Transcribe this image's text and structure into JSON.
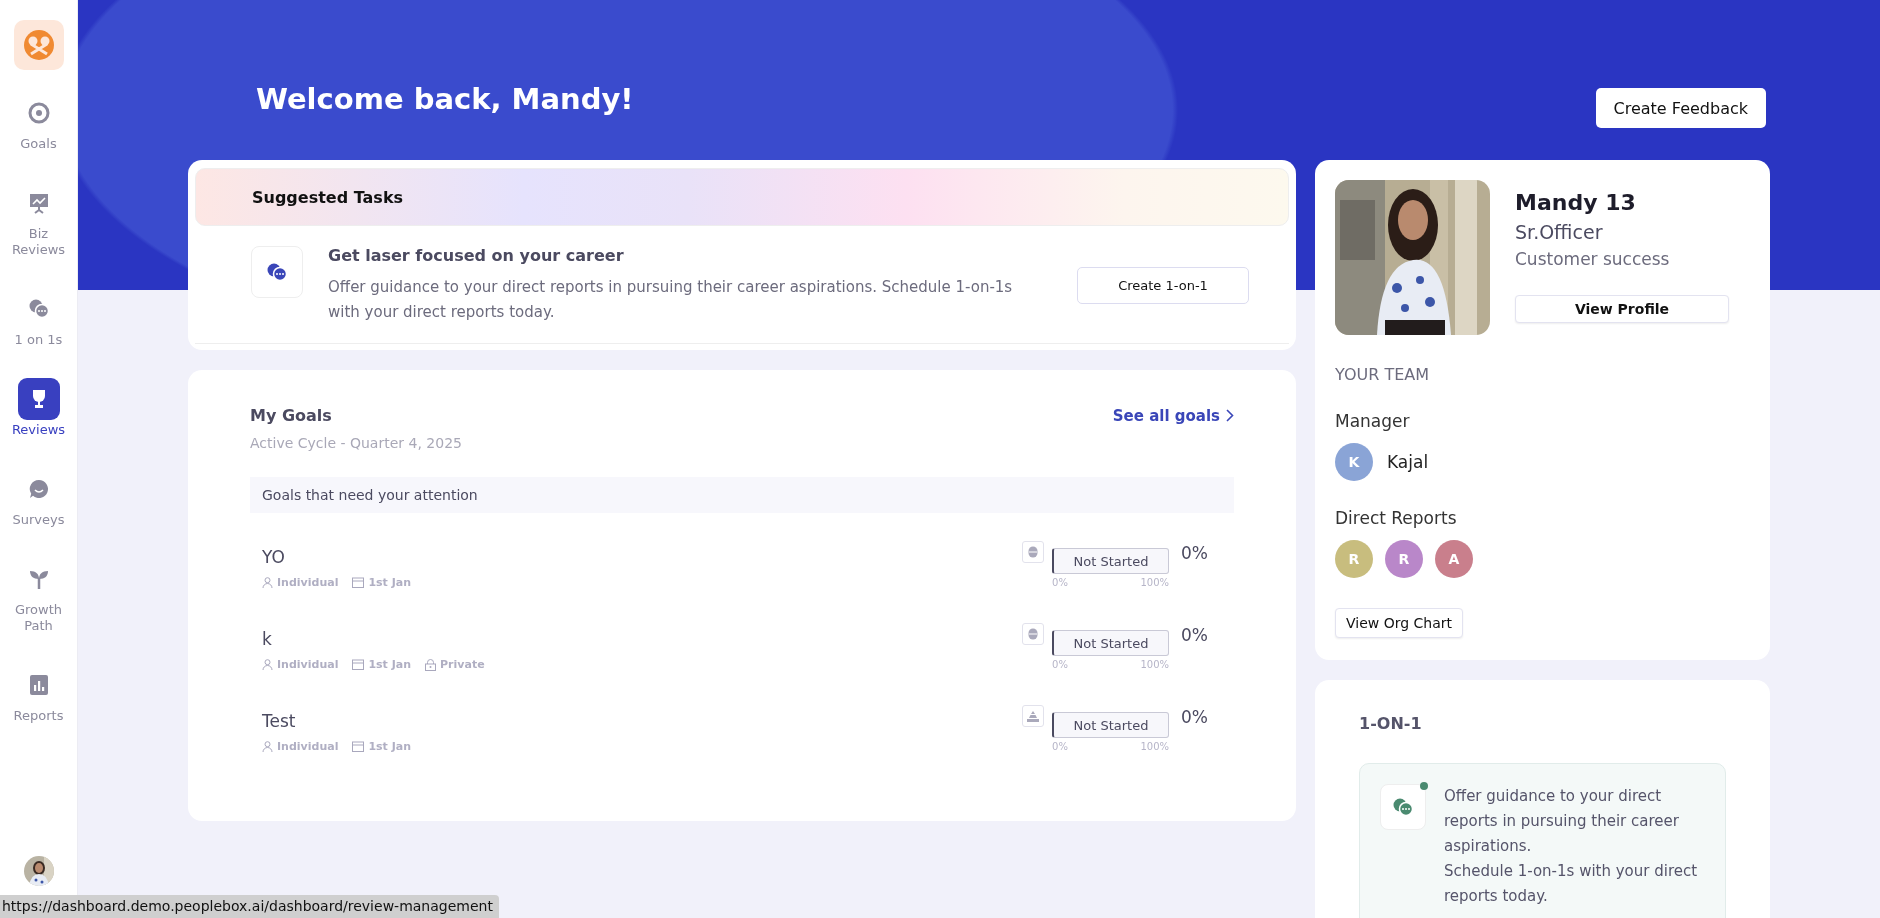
{
  "sidebar": {
    "items": [
      {
        "label": "Goals",
        "kind": "target",
        "selected": false
      },
      {
        "label": "Biz Reviews",
        "kind": "presentation",
        "selected": false
      },
      {
        "label": "1 on 1s",
        "kind": "chat",
        "selected": false
      },
      {
        "label": "Reviews",
        "kind": "trophy",
        "selected": true
      },
      {
        "label": "Surveys",
        "kind": "bubble",
        "selected": false
      },
      {
        "label": "Growth Path",
        "kind": "sprout",
        "selected": false
      },
      {
        "label": "Reports",
        "kind": "chart",
        "selected": false
      }
    ]
  },
  "header": {
    "title": "Welcome back, Mandy!",
    "button": "Create Feedback"
  },
  "suggested_tasks": {
    "title": "Suggested Tasks",
    "items": [
      {
        "title": "Get laser focused on your career",
        "description": "Offer guidance to your direct reports in pursuing their career aspirations. Schedule 1-on-1s with your direct reports today.",
        "button": "Create 1-on-1"
      }
    ]
  },
  "my_goals": {
    "title": "My Goals",
    "link": "See all goals",
    "subtitle": "Active Cycle - Quarter 4, 2025",
    "section": "Goals that need your attention",
    "goals": [
      {
        "name": "YO",
        "meta": [
          {
            "kind": "owner",
            "text": "Individual"
          },
          {
            "kind": "date",
            "text": "1st Jan"
          }
        ],
        "kind": "capsule",
        "status": "Not Started",
        "level": 0,
        "min": "0%",
        "max": "100%",
        "reading": "0%"
      },
      {
        "name": "k",
        "meta": [
          {
            "kind": "owner",
            "text": "Individual"
          },
          {
            "kind": "date",
            "text": "1st Jan"
          },
          {
            "kind": "privacy",
            "text": "Private"
          }
        ],
        "kind": "capsule",
        "status": "Not Started",
        "level": 0,
        "min": "0%",
        "max": "100%",
        "reading": "0%"
      },
      {
        "name": "Test",
        "meta": [
          {
            "kind": "owner",
            "text": "Individual"
          },
          {
            "kind": "date",
            "text": "1st Jan"
          }
        ],
        "kind": "pyramid",
        "status": "Not Started",
        "level": 0,
        "min": "0%",
        "max": "100%",
        "reading": "0%"
      }
    ]
  },
  "profile": {
    "name": "Mandy 13",
    "role": "Sr.Officer",
    "department": "Customer success",
    "button": "View Profile",
    "team_heading": "YOUR TEAM",
    "manager_label": "Manager",
    "manager": {
      "initial": "K",
      "name": "Kajal",
      "color": "#8aa4d6"
    },
    "direct_reports_label": "Direct Reports",
    "direct_reports": [
      {
        "initial": "R",
        "color": "#c8bd7e"
      },
      {
        "initial": "R",
        "color": "#b987c9"
      },
      {
        "initial": "A",
        "color": "#c97f8c"
      }
    ],
    "org_button": "View Org Chart"
  },
  "one_on_one": {
    "title": "1-ON-1",
    "tip": {
      "unread": true,
      "lines": [
        "Offer guidance to your direct reports in pursuing their career aspirations.",
        "Schedule 1-on-1s with your direct reports today."
      ]
    }
  },
  "status_bar": {
    "url": "https://dashboard.demo.peoplebox.ai/dashboard/review-management"
  }
}
